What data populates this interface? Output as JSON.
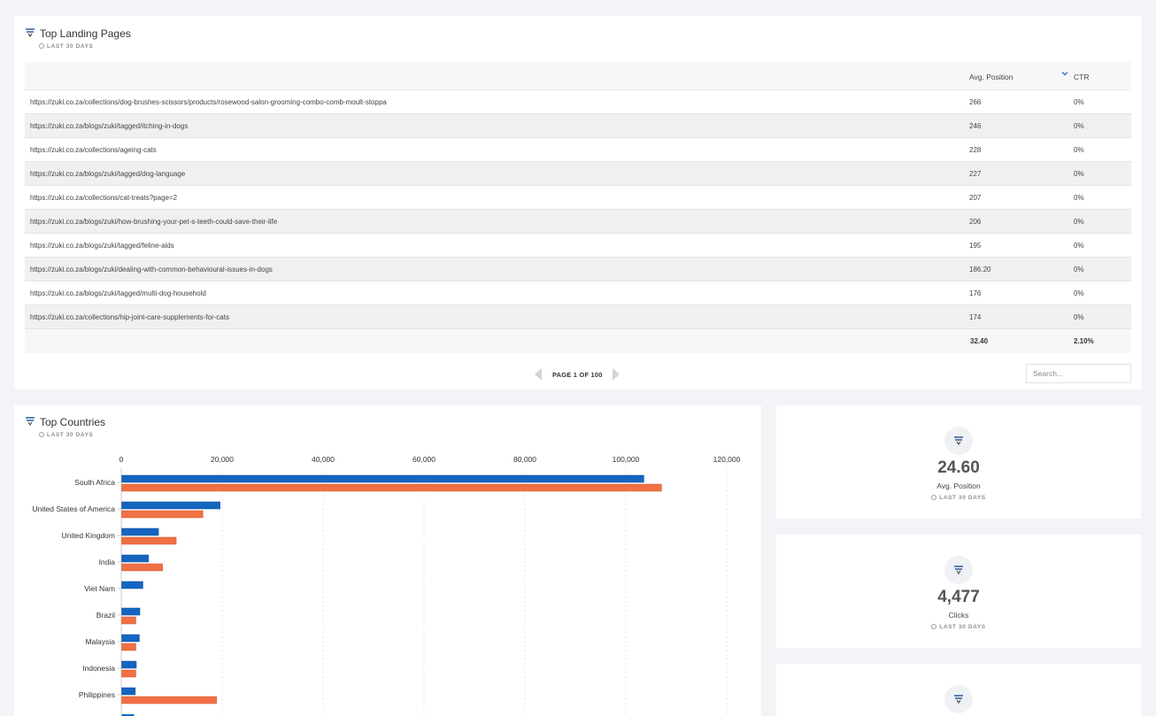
{
  "landing": {
    "title": "Top Landing Pages",
    "period": "LAST 30 DAYS",
    "columns": {
      "position": "Avg. Position",
      "ctr": "CTR"
    },
    "rows": [
      {
        "url": "https://zuki.co.za/collections/dog-brushes-scissors/products/rosewood-salon-grooming-combo-comb-moult-stoppa",
        "position": "266",
        "ctr": "0%"
      },
      {
        "url": "https://zuki.co.za/blogs/zuki/tagged/itching-in-dogs",
        "position": "246",
        "ctr": "0%"
      },
      {
        "url": "https://zuki.co.za/collections/ageing-cats",
        "position": "228",
        "ctr": "0%"
      },
      {
        "url": "https://zuki.co.za/blogs/zuki/tagged/dog-language",
        "position": "227",
        "ctr": "0%"
      },
      {
        "url": "https://zuki.co.za/collections/cat-treats?page=2",
        "position": "207",
        "ctr": "0%"
      },
      {
        "url": "https://zuki.co.za/blogs/zuki/how-brushing-your-pet-s-teeth-could-save-their-life",
        "position": "206",
        "ctr": "0%"
      },
      {
        "url": "https://zuki.co.za/blogs/zuki/tagged/feline-aids",
        "position": "195",
        "ctr": "0%"
      },
      {
        "url": "https://zuki.co.za/blogs/zuki/dealing-with-common-behavioural-issues-in-dogs",
        "position": "186.20",
        "ctr": "0%"
      },
      {
        "url": "https://zuki.co.za/blogs/zuki/tagged/multi-dog-household",
        "position": "176",
        "ctr": "0%"
      },
      {
        "url": "https://zuki.co.za/collections/hip-joint-care-supplements-for-cats",
        "position": "174",
        "ctr": "0%"
      }
    ],
    "totals": {
      "position": "32.40",
      "ctr": "2.10%"
    },
    "pager": "PAGE 1 OF 100",
    "search_placeholder": "Search..."
  },
  "countries": {
    "title": "Top Countries",
    "period": "LAST 30 DAYS"
  },
  "metrics": [
    {
      "value": "24.60",
      "label": "Avg. Position",
      "period": "LAST 30 DAYS"
    },
    {
      "value": "4,477",
      "label": "Clicks",
      "period": "LAST 30 DAYS"
    }
  ],
  "colors": {
    "series1": "#1565c0",
    "series2": "#f07045"
  },
  "chart_data": {
    "type": "bar",
    "orientation": "horizontal",
    "categories": [
      "South Africa",
      "United States of America",
      "United Kingdom",
      "India",
      "Viet Nam",
      "Brazil",
      "Malaysia",
      "Indonesia",
      "Philippines"
    ],
    "series": [
      {
        "values": [
          103500,
          19500,
          7300,
          5300,
          4200,
          3600,
          3500,
          2900,
          2700
        ]
      },
      {
        "values": [
          107000,
          16100,
          10800,
          8100,
          0,
          2800,
          2800,
          2800,
          18800
        ]
      }
    ],
    "x_ticks": [
      "0",
      "20,000",
      "40,000",
      "60,000",
      "80,000",
      "100,000",
      "120,000"
    ],
    "xlim": [
      0,
      120000
    ],
    "axis_position": "top",
    "grid": true
  }
}
